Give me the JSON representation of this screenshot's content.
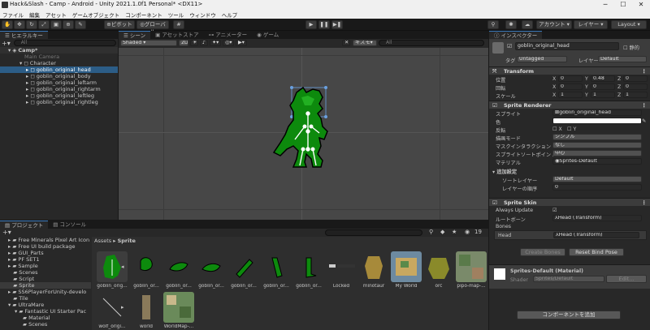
{
  "window": {
    "title": "Hack&Slash - Camp - Android - Unity 2021.1.0f1 Personal* <DX11>"
  },
  "menu": [
    "ファイル",
    "編集",
    "アセット",
    "ゲームオブジェクト",
    "コンポーネント",
    "ツール",
    "ウィンドウ",
    "ヘルプ"
  ],
  "toolbar": {
    "pivot": "ピボット",
    "global": "グローバル",
    "account": "アカウント",
    "layers": "レイヤー",
    "layout": "Layout"
  },
  "hierarchy": {
    "tab": "ヒエラルキー",
    "search_placeholder": "All",
    "scene": "Camp*",
    "items": [
      {
        "label": "Main Camera",
        "depth": 2,
        "disabled": true
      },
      {
        "label": "Character",
        "depth": 2
      },
      {
        "label": "goblin_original_head",
        "depth": 3,
        "selected": true
      },
      {
        "label": "goblin_original_body",
        "depth": 3
      },
      {
        "label": "goblin_original_leftarm",
        "depth": 3
      },
      {
        "label": "goblin_original_rightarm",
        "depth": 3
      },
      {
        "label": "goblin_original_leftleg",
        "depth": 3
      },
      {
        "label": "goblin_original_rightleg",
        "depth": 3
      }
    ]
  },
  "scene_view": {
    "tabs": [
      "シーン",
      "アセットストア",
      "アニメーター",
      "ゲーム"
    ],
    "shading": "Shaded",
    "gizmos": "ギズモ",
    "search_placeholder": "All"
  },
  "project": {
    "tabs": [
      "プロジェクト",
      "コンソール"
    ],
    "folders": [
      "Free Minerals Pixel Art Icon",
      "Free UI build package",
      "GUI_Parts",
      "PF SET1",
      "Sample",
      "Scenes",
      "Script",
      "Sprite",
      "SS6PlayerForUnity-develo",
      "Tile",
      "UltraMare",
      "Fantastic UI Starter Pac",
      "Material",
      "Scenes"
    ],
    "breadcrumb": [
      "Assets",
      "Sprite"
    ],
    "item_count": "19",
    "assets_row1": [
      "goblin_orig...",
      "goblin_or...",
      "goblin_or...",
      "goblin_or...",
      "goblin_or...",
      "goblin_or...",
      "goblin_or...",
      "Locked",
      "minotaur",
      "My World",
      "orc",
      "pipo-map-..."
    ],
    "assets_row2": [
      "wolf_origi...",
      "world",
      "WorldMap-..."
    ]
  },
  "inspector": {
    "tab": "インスペクター",
    "object_name": "goblin_original_head",
    "static_label": "静的",
    "tag_label": "タグ",
    "tag_value": "Untagged",
    "layer_label": "レイヤー",
    "layer_value": "Default",
    "transform": {
      "title": "Transform",
      "position_label": "位置",
      "rotation_label": "回転",
      "scale_label": "スケール",
      "position": [
        "0",
        "0.48",
        "0"
      ],
      "rotation": [
        "0",
        "0",
        "0"
      ],
      "scale": [
        "1",
        "1",
        "1"
      ]
    },
    "sprite_renderer": {
      "title": "Sprite Renderer",
      "sprite_label": "スプライト",
      "sprite_value": "goblin_original_head",
      "color_label": "色",
      "flip_label": "反転",
      "flip_x": "X",
      "flip_y": "Y",
      "draw_mode_label": "描画モード",
      "draw_mode": "シンプル",
      "mask_label": "マスクインタラクション",
      "mask_value": "なし",
      "sort_point_label": "スプライトソートポイント",
      "sort_point": "中心",
      "material_label": "マテリアル",
      "material_value": "Sprites-Default",
      "additional_label": "追加設定",
      "sorting_layer_label": "ソートレイヤー",
      "sorting_layer": "Default",
      "order_label": "レイヤーの順序",
      "order_value": "0"
    },
    "sprite_skin": {
      "title": "Sprite Skin",
      "always_update_label": "Always Update",
      "root_bone_label": "ルートボーン",
      "root_bone_value": "Head (Transform)",
      "bones_label": "Bones",
      "bone_name": "Head",
      "bone_value": "Head (Transform)",
      "create_bones": "Create Bones",
      "reset_bind_pose": "Reset Bind Pose"
    },
    "material": {
      "title": "Sprites-Default (Material)",
      "shader_label": "Shader",
      "shader_value": "Sprites/Default",
      "edit": "Edit..."
    },
    "add_component": "コンポーネントを追加"
  }
}
